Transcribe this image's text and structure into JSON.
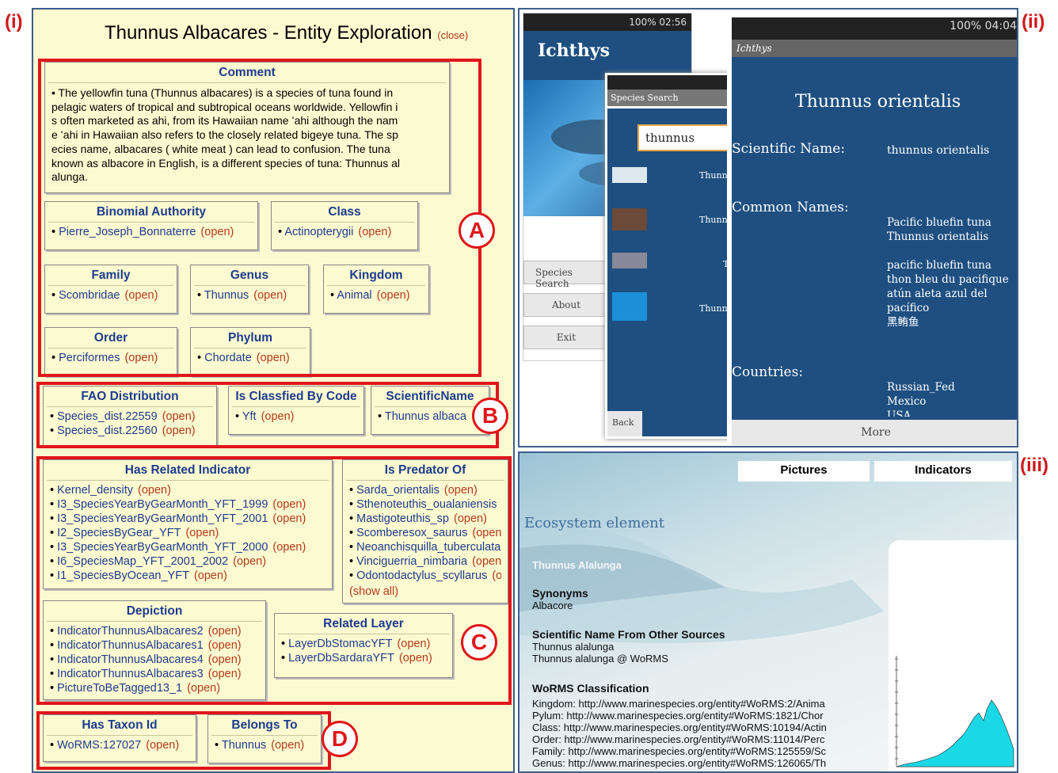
{
  "labels": {
    "i": "(i)",
    "ii": "(ii)",
    "iii": "(iii)"
  },
  "panel_i": {
    "title": "Thunnus Albacares - Entity Exploration",
    "close": "(close)",
    "comment": {
      "heading": "Comment",
      "lines": [
        "• The yellowfin tuna (Thunnus albacares) is a species of tuna found in",
        "pelagic waters of tropical and subtropical oceans worldwide. Yellowfin i",
        "s often marketed as ahi, from its Hawaiian name ʻahi although the nam",
        "e ʻahi in Hawaiian also refers to the closely related bigeye tuna. The sp",
        "ecies name, albacares ( white meat ) can lead to confusion. The tuna",
        "known as albacore in English, is a different species of tuna: Thunnus al",
        "alunga."
      ]
    },
    "open_label": "(open)",
    "show_all": "(show all)",
    "boxes": {
      "binomial": {
        "heading": "Binomial Authority",
        "items": [
          "Pierre_Joseph_Bonnaterre"
        ]
      },
      "class": {
        "heading": "Class",
        "items": [
          "Actinopterygii"
        ]
      },
      "family": {
        "heading": "Family",
        "items": [
          "Scombridae"
        ]
      },
      "genus": {
        "heading": "Genus",
        "items": [
          "Thunnus"
        ]
      },
      "kingdom": {
        "heading": "Kingdom",
        "items": [
          "Animal"
        ]
      },
      "order": {
        "heading": "Order",
        "items": [
          "Perciformes"
        ]
      },
      "phylum": {
        "heading": "Phylum",
        "items": [
          "Chordate"
        ]
      },
      "fao": {
        "heading": "FAO Distribution",
        "items": [
          "Species_dist.22559",
          "Species_dist.22560"
        ]
      },
      "classfied": {
        "heading": "Is Classfied By Code",
        "items": [
          "Yft"
        ]
      },
      "sciname": {
        "heading": "ScientificName",
        "items": [
          "Thunnus albaca"
        ]
      },
      "indicator": {
        "heading": "Has Related Indicator",
        "items": [
          "Kernel_density",
          "I3_SpeciesYearByGearMonth_YFT_1999",
          "I3_SpeciesYearByGearMonth_YFT_2001",
          "I2_SpeciesByGear_YFT",
          "I3_SpeciesYearByGearMonth_YFT_2000",
          "I6_SpeciesMap_YFT_2001_2002",
          "I1_SpeciesByOcean_YFT"
        ]
      },
      "predator": {
        "heading": "Is Predator Of",
        "items": [
          "Sarda_orientalis",
          "Sthenoteuthis_oualaniensis",
          "Mastigoteuthis_sp",
          "Scomberesox_saurus",
          "Neoanchisquilla_tuberculata",
          "Vinciguerria_nimbaria",
          "Odontodactylus_scyllarus"
        ]
      },
      "depiction": {
        "heading": "Depiction",
        "items": [
          "IndicatorThunnusAlbacares2",
          "IndicatorThunnusAlbacares1",
          "IndicatorThunnusAlbacares4",
          "IndicatorThunnusAlbacares3",
          "PictureToBeTagged13_1"
        ]
      },
      "layer": {
        "heading": "Related Layer",
        "items": [
          "LayerDbStomacYFT",
          "LayerDbSardaraYFT"
        ]
      },
      "taxon": {
        "heading": "Has Taxon Id",
        "items": [
          "WoRMS:127027"
        ]
      },
      "belongs": {
        "heading": "Belongs To",
        "items": [
          "Thunnus"
        ]
      }
    },
    "group_labels": {
      "a": "A",
      "b": "B",
      "c": "C",
      "d": "D"
    }
  },
  "panel_ii": {
    "phone1": {
      "status": "100% 02:56",
      "title": "Ichthys",
      "buttons": [
        "Species Search",
        "About",
        "Exit"
      ]
    },
    "phone2": {
      "title": "Species Search",
      "query": "thunnus",
      "results": [
        "Thunn",
        "Thunn",
        "T",
        "Thunn"
      ],
      "back": "Back"
    },
    "phone3": {
      "status": "100% 04:04",
      "app": "Ichthys",
      "species": "Thunnus orientalis",
      "sci_label": "Scientific Name:",
      "sci_value": "thunnus orientalis",
      "common_label": "Common Names:",
      "common_values": [
        "Pacific bluefin tuna",
        "Thunnus orientalis",
        "",
        "pacific bluefin tuna",
        "thon bleu du pacifique",
        "atún aleta azul del",
        "pacífico",
        "黑鲔鱼"
      ],
      "countries_label": "Countries:",
      "countries_values": [
        "Russian_Fed",
        "Mexico",
        "USA"
      ],
      "more": "More"
    }
  },
  "panel_iii": {
    "tabs": [
      "Pictures",
      "Indicators"
    ],
    "heading": "Ecosystem element",
    "species": "Thunnus Alalunga",
    "synonyms_label": "Synonyms",
    "synonyms": [
      "Albacore"
    ],
    "other_label": "Scientific Name From Other Sources",
    "other": [
      "Thunnus alalunga",
      "Thunnus alalunga @ WoRMS"
    ],
    "worms_label": "WoRMS Classification",
    "worms": [
      "Kingdom: http://www.marinespecies.org/entity#WoRMS:2/Anima",
      "Pylum: http://www.marinespecies.org/entity#WoRMS:1821/Chor",
      "Class: http://www.marinespecies.org/entity#WoRMS:10194/Actin",
      "Order: http://www.marinespecies.org/entity#WoRMS:11014/Perc",
      "Family: http://www.marinespecies.org/entity#WoRMS:125559/Sc",
      "Genus: http://www.marinespecies.org/entity#WoRMS:126065/Th"
    ],
    "colors": {
      "chart_fill": "#1ad8e6",
      "panel_border": "#3c5e8c",
      "annotation_red": "#e0161b"
    }
  }
}
